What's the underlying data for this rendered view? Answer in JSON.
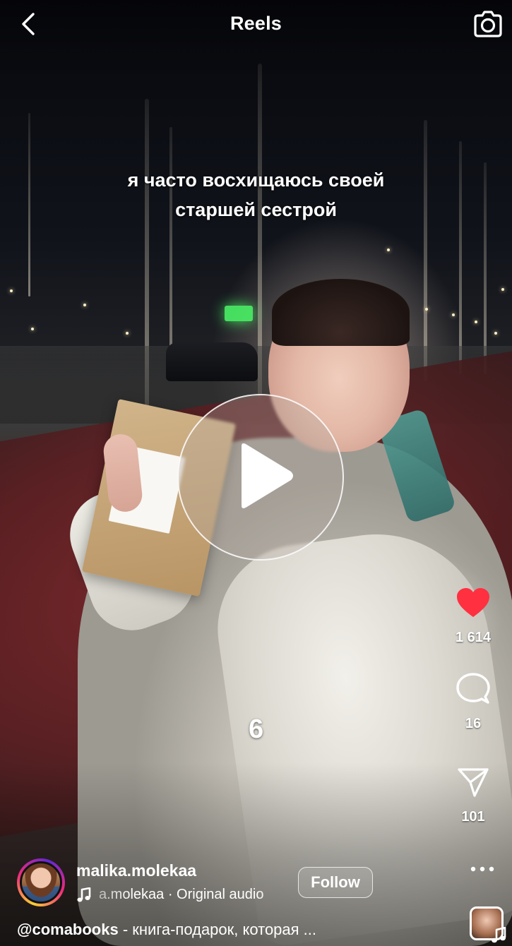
{
  "header": {
    "title": "Reels"
  },
  "video": {
    "caption_lines": [
      "я часто восхищаюсь своей",
      "старшей сестрой"
    ],
    "overlay_number": "6"
  },
  "actions": {
    "likes": "1 614",
    "comments": "16",
    "shares": "101",
    "like_color": "#ff3040"
  },
  "user": {
    "username": "malika.molekaa",
    "audio": "a.molekaa · Original audio",
    "follow_label": "Follow"
  },
  "description": {
    "mention": "@comabooks",
    "text": " - книга-подарок, которая ..."
  },
  "icons": {
    "back": "back-chevron-icon",
    "camera": "camera-icon",
    "play": "play-icon",
    "like": "heart-icon",
    "comment": "comment-bubble-icon",
    "share": "paper-plane-icon",
    "more": "more-dots-icon",
    "music": "music-note-icon"
  }
}
